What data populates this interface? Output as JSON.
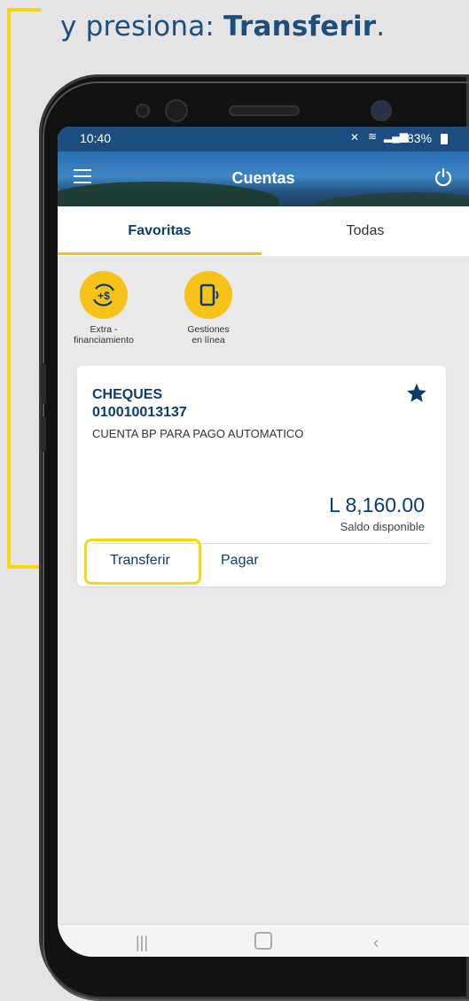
{
  "instruction": {
    "prefix": "y presiona: ",
    "emphasis": "Transferir",
    "suffix": "."
  },
  "status_bar": {
    "time": "10:40",
    "battery": "83%"
  },
  "header": {
    "title": "Cuentas"
  },
  "tabs": [
    {
      "label": "Favoritas",
      "active": true
    },
    {
      "label": "Todas",
      "active": false
    }
  ],
  "quick_actions": [
    {
      "line1": "Extra -",
      "line2": "financiamiento",
      "icon": "money-cycle-icon"
    },
    {
      "line1": "Gestiones",
      "line2": "en línea",
      "icon": "phone-signal-icon"
    }
  ],
  "account_card": {
    "type": "CHEQUES",
    "number": "010010013137",
    "description": "CUENTA BP PARA PAGO AUTOMATICO",
    "amount": "L 8,160.00",
    "balance_label": "Saldo disponible",
    "favorite": true,
    "actions": [
      {
        "label": "Transferir",
        "highlighted": true
      },
      {
        "label": "Pagar",
        "highlighted": false
      }
    ]
  },
  "colors": {
    "brand_blue": "#0d3c69",
    "accent_yellow": "#f7c31a",
    "highlight_yellow": "#f5d90a",
    "status_bar": "#1b4d80"
  }
}
